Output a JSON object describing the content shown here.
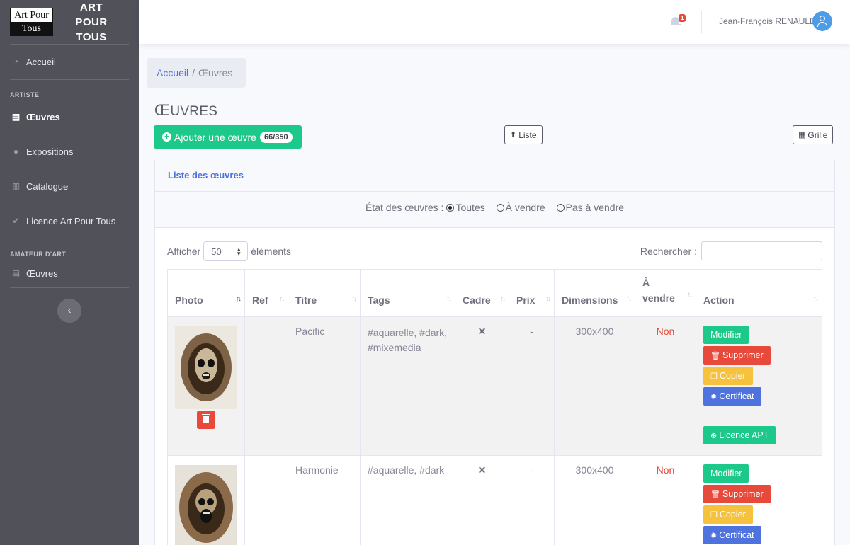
{
  "brand": {
    "logo_top": "Art Pour",
    "logo_bottom": "Tous",
    "name": "ART POUR TOUS"
  },
  "sidebar": {
    "home": "Accueil",
    "section_artist": "ARTISTE",
    "artist_items": [
      {
        "label": "Œuvres",
        "icon": "file-icon"
      },
      {
        "label": "Expositions",
        "icon": "users-icon"
      },
      {
        "label": "Catalogue",
        "icon": "book-icon"
      },
      {
        "label": "Licence Art Pour Tous",
        "icon": "check-circle-icon"
      }
    ],
    "section_amateur": "AMATEUR D'ART",
    "amateur_items": [
      {
        "label": "Œuvres",
        "icon": "file-icon"
      }
    ]
  },
  "topbar": {
    "notifications": "1",
    "user_name": "Jean-François RENAULD"
  },
  "breadcrumb": {
    "home": "Accueil",
    "separator": "/",
    "current": "Œuvres"
  },
  "page": {
    "title_first": "Œ",
    "title_rest": "UVRES"
  },
  "toolbar": {
    "add_label": "Ajouter une œuvre",
    "add_count": "66/350",
    "list_label": "Liste",
    "grid_label": "Grille"
  },
  "card": {
    "title": "Liste des œuvres",
    "filter_label": "État des œuvres :",
    "filter_options": [
      "Toutes",
      "À vendre",
      "Pas à vendre"
    ],
    "filter_selected": "Toutes",
    "length_prefix": "Afficher",
    "length_value": "50",
    "length_suffix": "éléments",
    "search_label": "Rechercher :"
  },
  "table": {
    "headers": [
      "Photo",
      "Ref",
      "Titre",
      "Tags",
      "Cadre",
      "Prix",
      "Dimensions",
      "À vendre",
      "Action"
    ],
    "rows": [
      {
        "ref": "",
        "title": "Pacific",
        "tags": "#aquarelle, #dark, #mixemedia",
        "frame": "✕",
        "price": "-",
        "dims": "300x400",
        "for_sale": "Non"
      },
      {
        "ref": "",
        "title": "Harmonie",
        "tags": "#aquarelle, #dark",
        "frame": "✕",
        "price": "-",
        "dims": "300x400",
        "for_sale": "Non"
      }
    ],
    "actions": {
      "edit": "Modifier",
      "delete": "Supprimer",
      "copy": "Copier",
      "certificate": "Certificat",
      "license": "Licence APT"
    }
  },
  "colors": {
    "sidebar": "#505159",
    "primary": "#4e73df",
    "success": "#1cc88a",
    "danger": "#e74a3b",
    "warning": "#f6c23e"
  }
}
